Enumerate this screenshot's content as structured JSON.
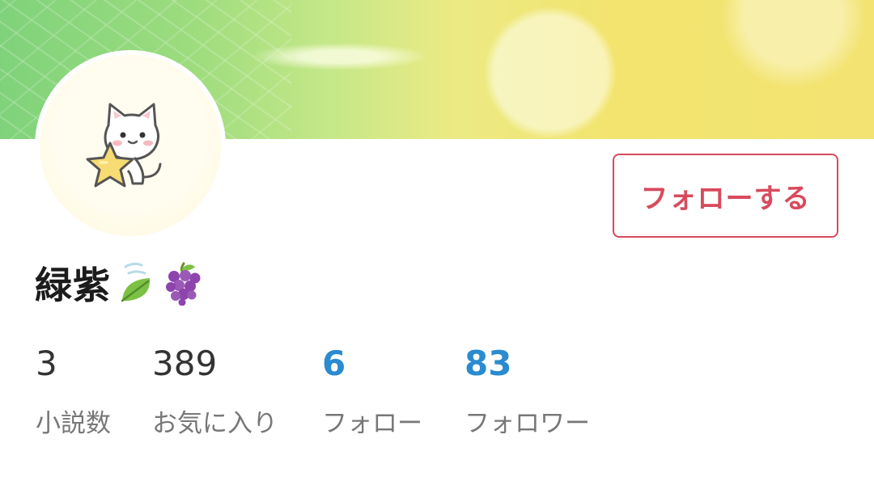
{
  "header": {
    "follow_button_label": "フォローする"
  },
  "profile": {
    "name": "緑紫",
    "name_emojis": [
      "leaf-icon",
      "grapes-icon"
    ],
    "avatar_icon": "cat-with-star-icon"
  },
  "stats": [
    {
      "value": "3",
      "label": "小説数",
      "link": false
    },
    {
      "value": "389",
      "label": "お気に入り",
      "link": false
    },
    {
      "value": "6",
      "label": "フォロー",
      "link": true
    },
    {
      "value": "83",
      "label": "フォロワー",
      "link": true
    }
  ],
  "colors": {
    "accent": "#d84a5c",
    "link": "#2a8bd0",
    "text": "#1c1c1c",
    "muted": "#777777"
  }
}
